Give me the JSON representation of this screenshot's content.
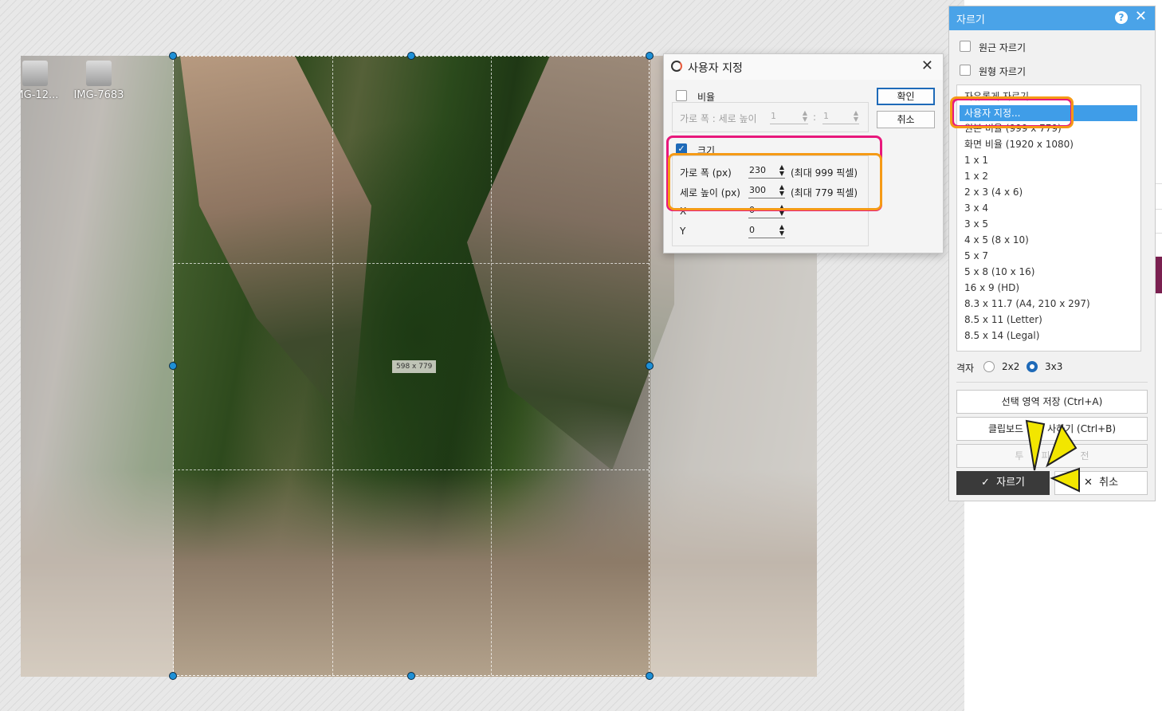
{
  "desktop_icons": [
    "IMG-12...",
    "IMG-7683"
  ],
  "crop": {
    "size_label": "598 x 779"
  },
  "dialog": {
    "title": "사용자 지정",
    "ratio_label": "비율",
    "ratio_sub_label": "가로 폭 : 세로 높이",
    "ratio_w": "1",
    "ratio_h": "1",
    "ratio_colon": ":",
    "size_label": "크기",
    "width_label": "가로 폭 (px)",
    "width_value": "230",
    "width_max": "(최대 999 픽셀)",
    "height_label": "세로 높이 (px)",
    "height_value": "300",
    "height_max": "(최대 779 픽셀)",
    "x_label": "X",
    "x_value": "0",
    "y_label": "Y",
    "y_value": "0",
    "ok_label": "확인",
    "cancel_label": "취소"
  },
  "panel": {
    "title": "자르기",
    "help": "?",
    "option_circle": "원근 자르기",
    "option_round": "원형 자르기",
    "list": [
      "자유롭게 자르기",
      "사용자 지정...",
      "원본 비율 (999 x 779)",
      "화면 비율 (1920 x 1080)",
      "1 x 1",
      "1 x 2",
      "2 x 3 (4 x 6)",
      "3 x 4",
      "3 x 5",
      "4 x 5 (8 x 10)",
      "5 x 7",
      "5 x 8 (10 x 16)",
      "16 x 9 (HD)",
      "8.3 x 11.7 (A4, 210 x 297)",
      "8.5 x 11 (Letter)",
      "8.5 x 14 (Legal)"
    ],
    "selected_index": 1,
    "grid_label": "격자",
    "grid_2x2": "2x2",
    "grid_3x3": "3x3",
    "grid_selected": "3x3",
    "save_selection": "선택 영역 저장 (Ctrl+A)",
    "clipboard_left": "클립보드",
    "clipboard_right": "사하기 (Ctrl+B)",
    "disabled_left": "투",
    "disabled_mid": "피",
    "disabled_right": "전",
    "crop_button": "자르기",
    "cancel_button": "취소"
  },
  "colors": {
    "accent": "#4aa3e8",
    "highlight_pink": "#e8187c",
    "highlight_orange": "#f59a16",
    "arrow_yellow": "#f2e600"
  }
}
